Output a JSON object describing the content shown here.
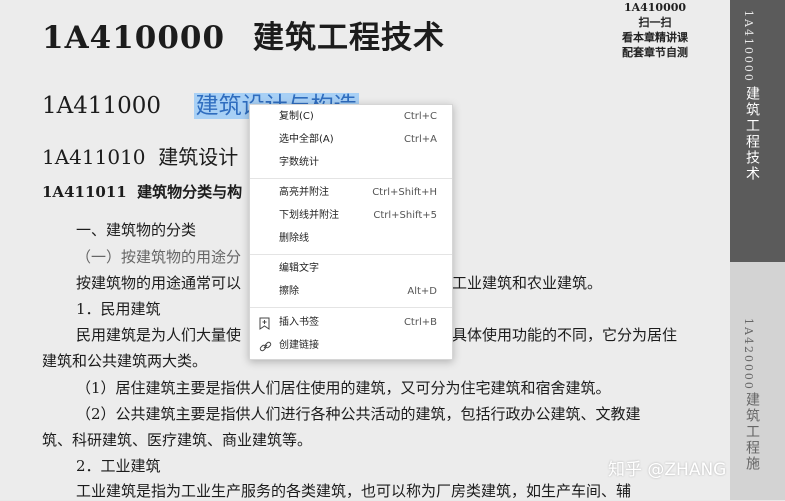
{
  "document": {
    "title_code": "1A410000",
    "title_text": "建筑工程技术",
    "section_code": "1A411000",
    "section_text": "建筑设计与构造",
    "subsection_line": "1A411010  建筑设计",
    "subsub_line": "1A411011  建筑物分类与构",
    "lines": [
      "一、建筑物的分类",
      "（一）按建筑物的用途分",
      "按建筑物的用途通常可以",
      "工业建筑和农业建筑。",
      "1．民用建筑",
      "民用建筑是为人们大量使",
      "具体使用功能的不同，它分为居住",
      "建筑和公共建筑两大类。",
      "（1）居住建筑主要是指供人们居住使用的建筑，又可分为住宅建筑和宿舍建筑。",
      "（2）公共建筑主要是指供人们进行各种公共活动的建筑，包括行政办公建筑、文教建",
      "筑、科研建筑、医疗建筑、商业建筑等。",
      "2．工业建筑",
      "工业建筑是指为工业生产服务的各类建筑，也可以称为厂房类建筑，如生产车间、辅"
    ],
    "top_right": [
      "1A410000",
      "扫一扫",
      "看本章精讲课",
      "配套章节自测"
    ],
    "side_tab_1": "1A410000",
    "side_tab_1_text": "建筑工程技术",
    "side_tab_2": "1A420000",
    "side_tab_2_text": "建筑工程施"
  },
  "context_menu": {
    "copy": {
      "label": "复制(C)",
      "shortcut": "Ctrl+C"
    },
    "select_all": {
      "label": "选中全部(A)",
      "shortcut": "Ctrl+A"
    },
    "word_count": {
      "label": "字数统计"
    },
    "highlight_note": {
      "label": "高亮并附注",
      "shortcut": "Ctrl+Shift+H"
    },
    "underline_note": {
      "label": "下划线并附注",
      "shortcut": "Ctrl+Shift+5"
    },
    "strikethrough": {
      "label": "删除线"
    },
    "edit_text": {
      "label": "编辑文字"
    },
    "erase": {
      "label": "擦除",
      "shortcut": "Alt+D"
    },
    "insert_bookmark": {
      "label": "插入书签",
      "shortcut": "Ctrl+B"
    },
    "create_link": {
      "label": "创建链接"
    }
  },
  "watermark": "知乎 @ZHANG",
  "colors": {
    "highlight": "#a8d0f5",
    "side_tab_dark": "#5b5b5b",
    "menu_bg": "#ffffff"
  }
}
